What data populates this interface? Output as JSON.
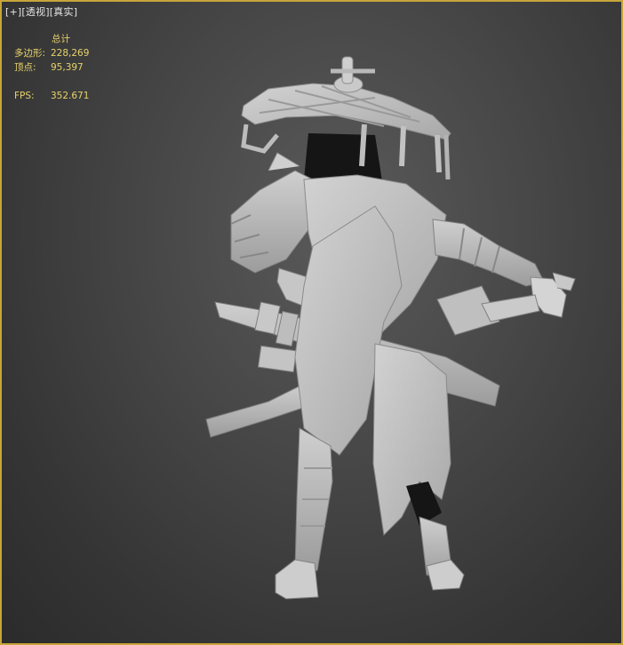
{
  "viewport": {
    "label_plus": "[+]",
    "label_view": "[透视]",
    "label_shading": "[真实]",
    "border_color": "#c8a43a"
  },
  "stats": {
    "header": "总计",
    "polys_label": "多边形:",
    "polys_value": "228,269",
    "verts_label": "顶点:",
    "verts_value": "95,397",
    "fps_label": "FPS:",
    "fps_value": "352.671",
    "text_color": "#e8d36a"
  }
}
